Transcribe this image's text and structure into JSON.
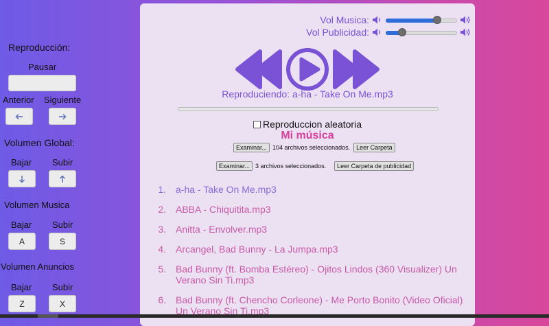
{
  "left_panel": {
    "playback_heading": "Reproducción:",
    "pause_label": "Pausar",
    "pause_button_text": "",
    "previous_label": "Anterior",
    "next_label": "Siguiente",
    "previous_icon": "arrow-left-icon",
    "next_icon": "arrow-right-icon",
    "global_volume_heading": "Volumen Global:",
    "global_down_label": "Bajar",
    "global_up_label": "Subir",
    "global_down_icon": "arrow-down-icon",
    "global_up_icon": "arrow-up-icon",
    "music_volume_heading": "Volumen Musica",
    "music_down_label": "Bajar",
    "music_up_label": "Subir",
    "music_down_key": "A",
    "music_up_key": "S",
    "ads_volume_heading": "Volumen Anuncios",
    "ads_down_label": "Bajar",
    "ads_up_label": "Subir",
    "ads_down_key": "Z",
    "ads_up_key": "X"
  },
  "volume": {
    "music_label": "Vol Musica:",
    "music_level": 0.72,
    "ads_label": "Vol Publicidad:",
    "ads_level": 0.23,
    "low_icon": "speaker-low-icon",
    "high_icon": "speaker-high-icon"
  },
  "player": {
    "icons": [
      "rewind-icon",
      "play-icon",
      "fast-forward-icon"
    ],
    "now_playing": "Reproduciendo: a-ha - Take On Me.mp3",
    "progress": 0,
    "shuffle_label": "Reproduccion aleatoria",
    "shuffle_checked": false
  },
  "library": {
    "title": "Mi música",
    "music_browse_button": "Examinar...",
    "music_files_status": "104 archivos seleccionados.",
    "read_folder_button": "Leer Carpeta",
    "ads_browse_button": "Examinar...",
    "ads_files_status": "3 archivos seleccionados.",
    "read_ads_folder_button": "Leer Carpeta de publicidad"
  },
  "tracks": [
    {
      "num": "1.",
      "name": "a-ha - Take On Me.mp3"
    },
    {
      "num": "2.",
      "name": "ABBA - Chiquitita.mp3"
    },
    {
      "num": "3.",
      "name": "Anitta - Envolver.mp3"
    },
    {
      "num": "4.",
      "name": "Arcangel, Bad Bunny - La Jumpa.mp3"
    },
    {
      "num": "5.",
      "name": "Bad Bunny (ft. Bomba Estéreo) - Ojitos Lindos (360 Visualizer) Un Verano Sin Ti.mp3"
    },
    {
      "num": "6.",
      "name": "Bad Bunny (ft. Chencho Corleone) - Me Porto Bonito (Video Oficial) Un Verano Sin Ti.mp3"
    }
  ],
  "colors": {
    "accent": "#7a52d6",
    "pink": "#d63f9c",
    "active_track": "#8b6ad8",
    "track": "#c85aa6",
    "slider_fill": "#2f6ed8"
  }
}
